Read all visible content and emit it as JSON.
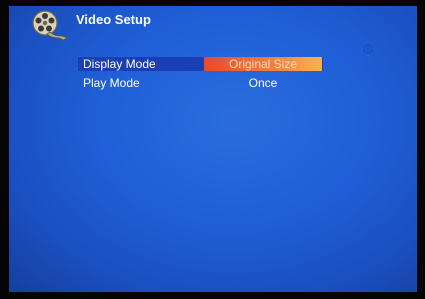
{
  "header": {
    "title": "Video Setup",
    "icon": "film-reel-icon"
  },
  "menu": {
    "items": [
      {
        "label": "Display Mode",
        "value": "Original Size",
        "selected": true
      },
      {
        "label": "Play Mode",
        "value": "Once",
        "selected": false
      }
    ]
  },
  "colors": {
    "background": "#1f5ed6",
    "highlight_start": "#e84a2e",
    "highlight_end": "#f7b350",
    "text": "#ffffff"
  }
}
